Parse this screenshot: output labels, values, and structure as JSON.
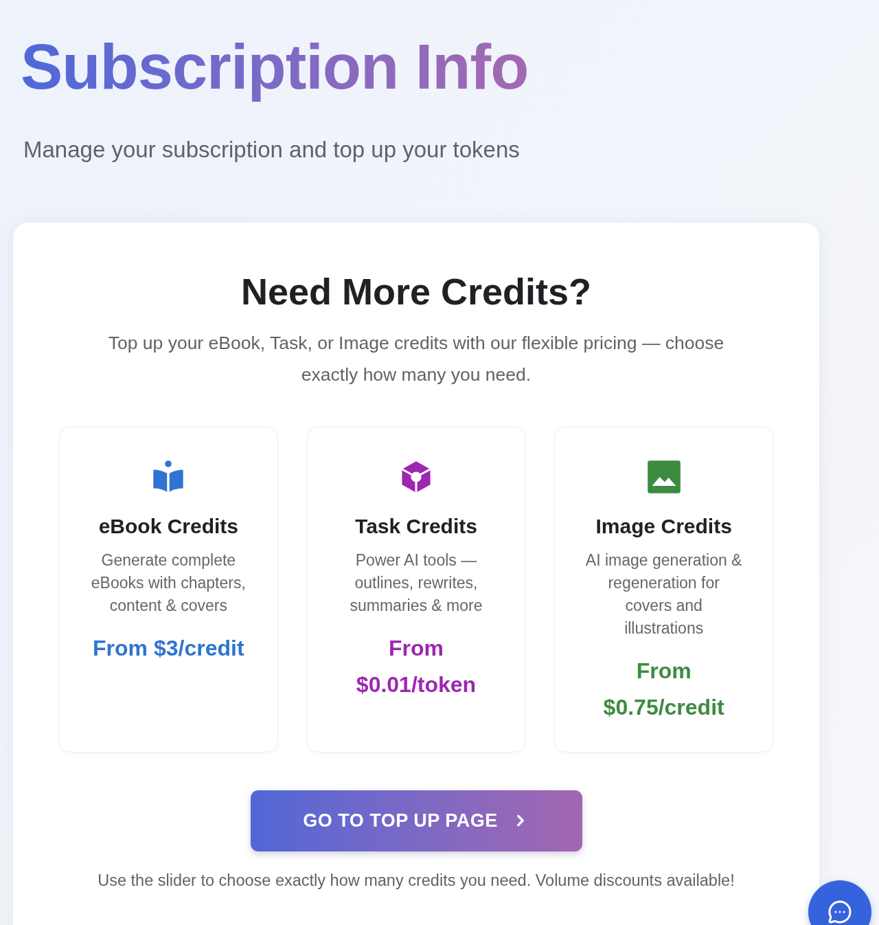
{
  "header": {
    "title": "Subscription Info",
    "subtitle": "Manage your subscription and top up your tokens"
  },
  "credits_panel": {
    "title": "Need More Credits?",
    "description": "Top up your eBook, Task, or Image credits with our flexible pricing — choose exactly how many you need.",
    "plans": [
      {
        "kind": "ebook",
        "title": "eBook Credits",
        "description": "Generate complete eBooks with chapters, content & covers",
        "price": "From $3/credit",
        "color": "#2f74d0"
      },
      {
        "kind": "task",
        "title": "Task Credits",
        "description": "Power AI tools — outlines, rewrites, summaries & more",
        "price": "From $0.01/token",
        "color": "#9c27b0"
      },
      {
        "kind": "image",
        "title": "Image Credits",
        "description": "AI image generation & regeneration for covers and illustrations",
        "price": "From $0.75/credit",
        "color": "#3d8b40"
      }
    ],
    "button": {
      "label": "GO TO TOP UP PAGE"
    },
    "note": "Use the slider to choose exactly how many credits you need. Volume discounts available!"
  }
}
